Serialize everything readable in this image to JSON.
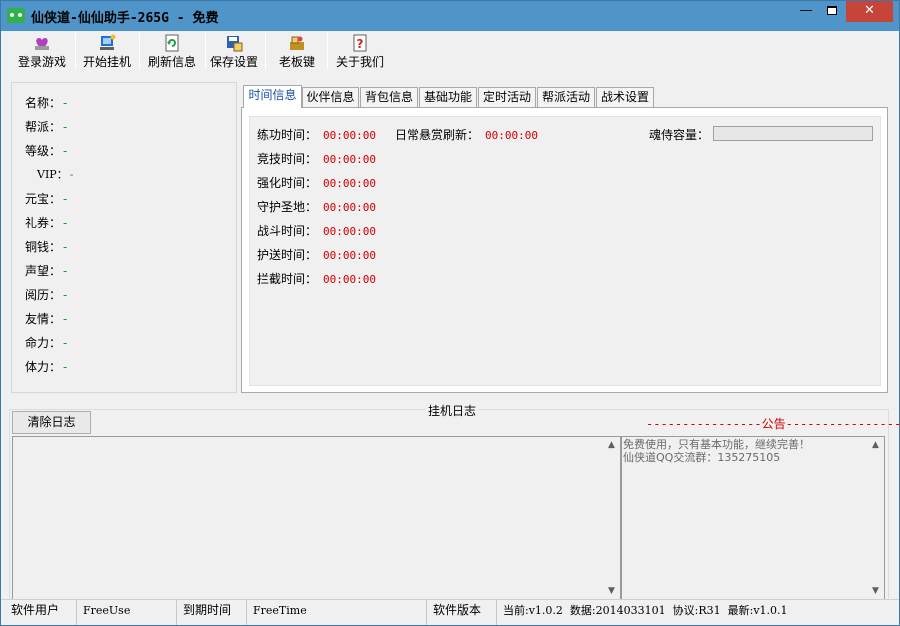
{
  "window": {
    "title": "仙侠道-仙仙助手-265G - 免费",
    "minimize": "—",
    "close": "✕"
  },
  "toolbar": [
    {
      "label": "登录游戏",
      "icon": "login-icon",
      "color": "#b040c0"
    },
    {
      "label": "开始挂机",
      "icon": "start-icon",
      "color": "#2070d0"
    },
    {
      "label": "刷新信息",
      "icon": "refresh-icon",
      "color": "#20a040"
    },
    {
      "label": "保存设置",
      "icon": "save-icon",
      "color": "#3060b0"
    },
    {
      "label": "老板键",
      "icon": "boss-key-icon",
      "color": "#c09020"
    },
    {
      "label": "关于我们",
      "icon": "help-icon",
      "color": "#d02020"
    }
  ],
  "info": [
    {
      "label": "名称：",
      "value": "-"
    },
    {
      "label": "帮派：",
      "value": "-"
    },
    {
      "label": "等级：",
      "value": "-"
    },
    {
      "label": "VIP：",
      "value": "-"
    },
    {
      "label": "元宝：",
      "value": "-"
    },
    {
      "label": "礼券：",
      "value": "-"
    },
    {
      "label": "铜钱：",
      "value": "-"
    },
    {
      "label": "声望：",
      "value": "-"
    },
    {
      "label": "阅历：",
      "value": "-"
    },
    {
      "label": "友情：",
      "value": "-"
    },
    {
      "label": "命力：",
      "value": "-"
    },
    {
      "label": "体力：",
      "value": "-"
    }
  ],
  "tabs": [
    "时间信息",
    "伙伴信息",
    "背包信息",
    "基础功能",
    "定时活动",
    "帮派活动",
    "战术设置"
  ],
  "active_tab": "时间信息",
  "timers": [
    {
      "label": "练功时间：",
      "value": "00:00:00"
    },
    {
      "label": "竞技时间：",
      "value": "00:00:00"
    },
    {
      "label": "强化时间：",
      "value": "00:00:00"
    },
    {
      "label": "守护圣地：",
      "value": "00:00:00"
    },
    {
      "label": "战斗时间：",
      "value": "00:00:00"
    },
    {
      "label": "护送时间：",
      "value": "00:00:00"
    },
    {
      "label": "拦截时间：",
      "value": "00:00:00"
    }
  ],
  "daily_refresh": {
    "label": "日常悬赏刷新：",
    "value": "00:00:00"
  },
  "soul_capacity": {
    "label": "魂侍容量："
  },
  "log": {
    "title": "挂机日志",
    "clear_button": "清除日志",
    "notice_header": "----------------公告----------------",
    "notice_lines": [
      "免费使用，只有基本功能，继续完善！",
      "仙侠道QQ交流群：135275105"
    ]
  },
  "status": {
    "user_label": "软件用户",
    "user_value": "FreeUse",
    "expire_label": "到期时间",
    "expire_value": "FreeTime",
    "version_label": "软件版本",
    "current": "当前:v1.0.2",
    "data": "数据:2014033101",
    "protocol": "协议:R31",
    "latest": "最新:v1.0.1"
  }
}
